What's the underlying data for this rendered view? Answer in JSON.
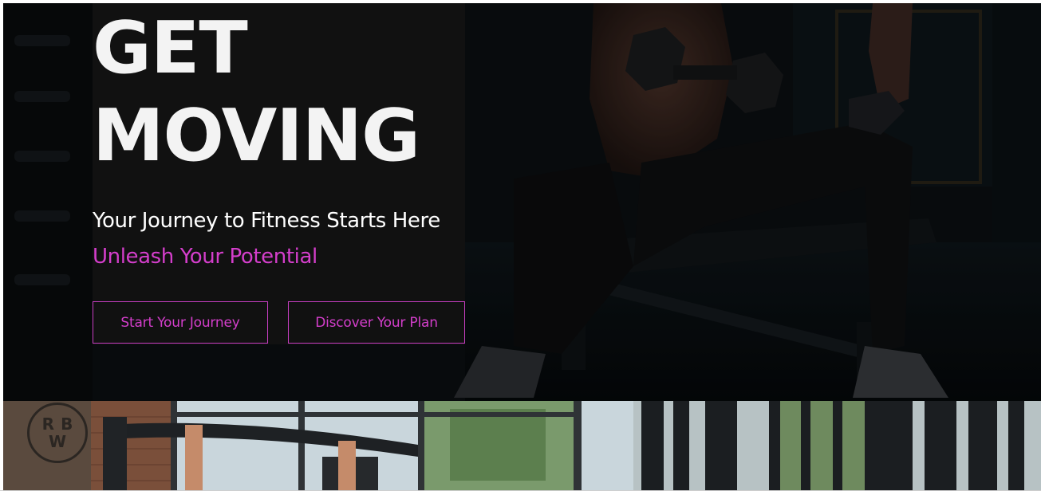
{
  "hero": {
    "headline_line1": "GET",
    "headline_line2": "MOVING",
    "subtitle": "Your Journey to Fitness Starts Here",
    "tagline": "Unleash Your Potential",
    "buttons": {
      "start_label": "Start Your Journey",
      "discover_label": "Discover Your Plan"
    }
  },
  "gym_strip": {
    "logo_letters": [
      "R",
      "B",
      "W"
    ]
  },
  "colors": {
    "accent": "#d43ecb",
    "hero_panel": "#111111",
    "headline": "#f3f3f3"
  }
}
